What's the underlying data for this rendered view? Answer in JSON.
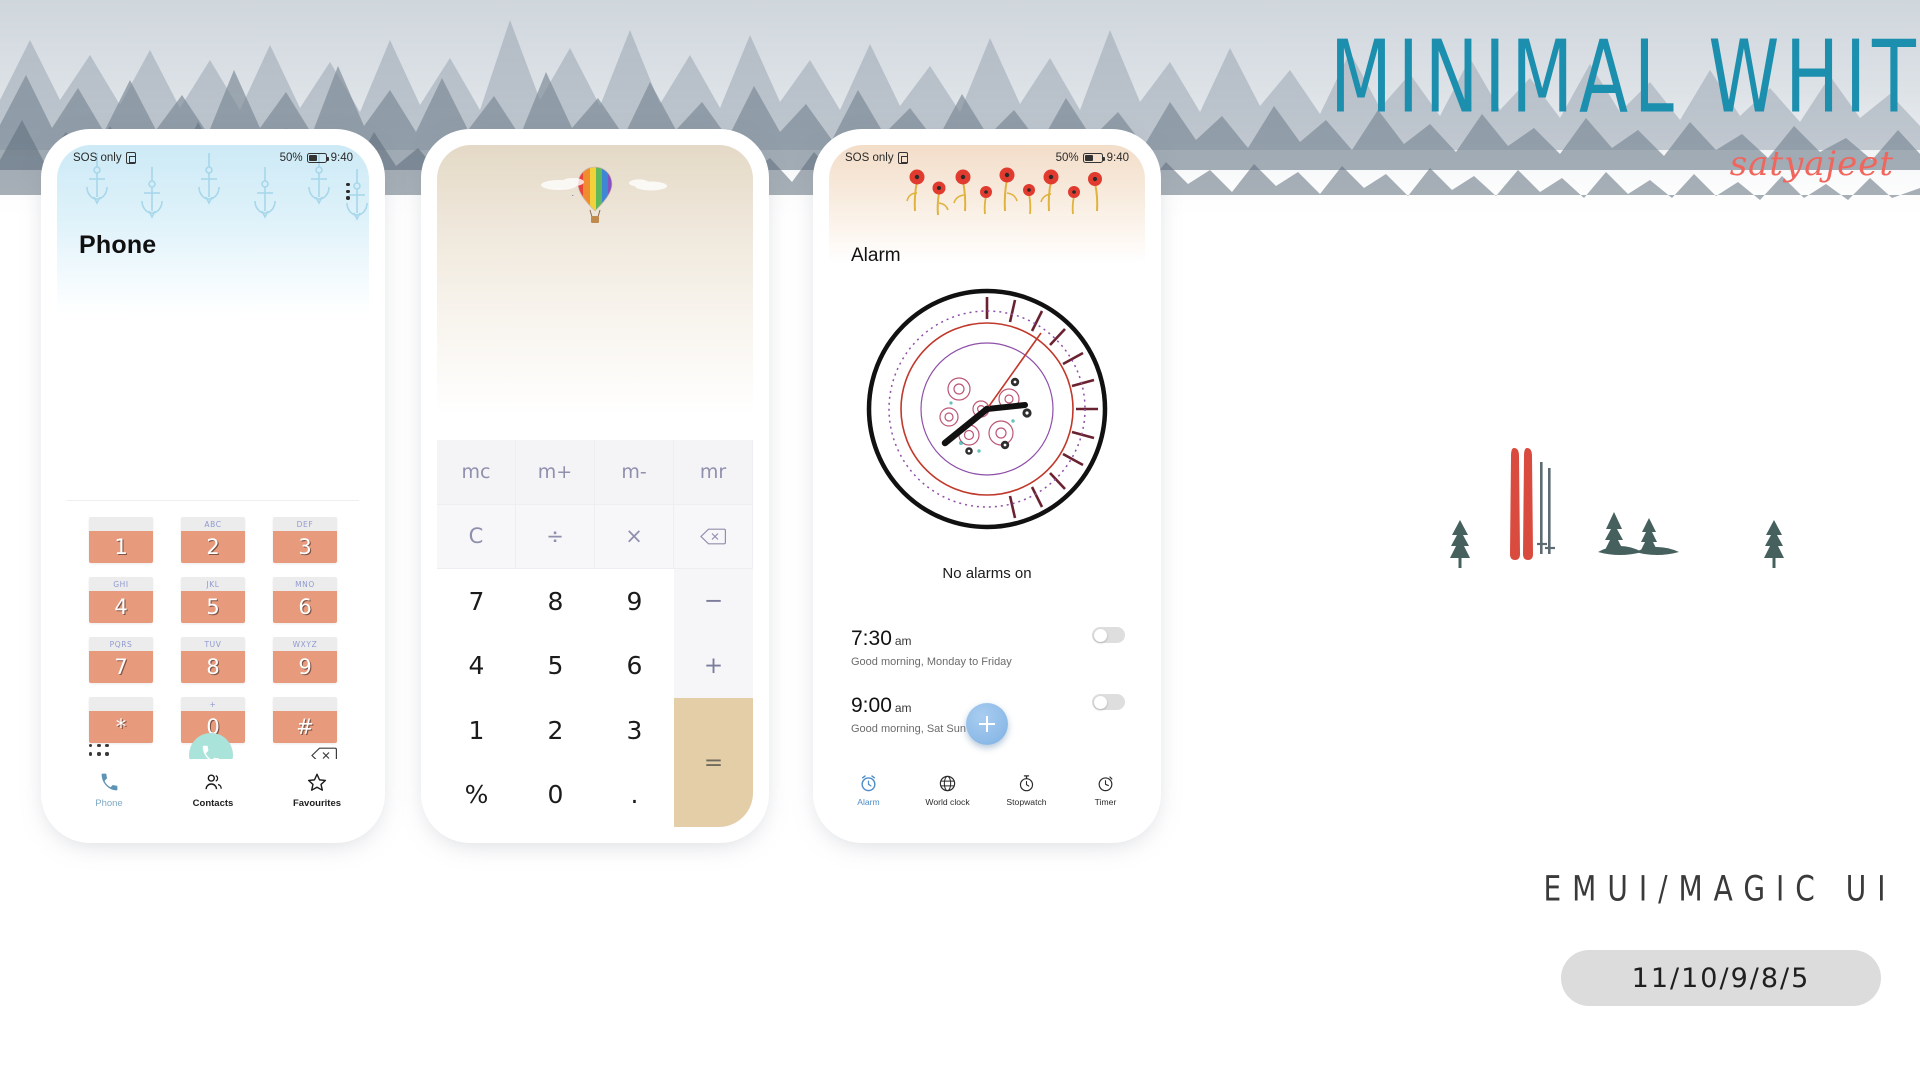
{
  "brand": {
    "title": "MINIMAL WHITE",
    "author": "satyajeet"
  },
  "footer": {
    "platform": "EMUI/MAGIC UI",
    "versions": "11/10/9/8/5"
  },
  "colors": {
    "brand_teal": "#1d8fae",
    "author_coral": "#f0655c",
    "dial_key": "#e89a7d",
    "call_button": "#a9e3da",
    "equals_key": "#e3cea8",
    "fab_blue": "#7fb1e3",
    "active_tab_blue": "#7fa8c4"
  },
  "phone_app": {
    "status": {
      "carrier": "SOS only",
      "battery_pct": "50%",
      "time": "9:40"
    },
    "title": "Phone",
    "keys": [
      {
        "num": "1",
        "letters": ""
      },
      {
        "num": "2",
        "letters": "ABC"
      },
      {
        "num": "3",
        "letters": "DEF"
      },
      {
        "num": "4",
        "letters": "GHI"
      },
      {
        "num": "5",
        "letters": "JKL"
      },
      {
        "num": "6",
        "letters": "MNO"
      },
      {
        "num": "7",
        "letters": "PQRS"
      },
      {
        "num": "8",
        "letters": "TUV"
      },
      {
        "num": "9",
        "letters": "WXYZ"
      },
      {
        "num": "*",
        "letters": ""
      },
      {
        "num": "0",
        "letters": "+"
      },
      {
        "num": "#",
        "letters": ""
      }
    ],
    "tabs": [
      {
        "label": "Phone",
        "icon": "phone-icon",
        "active": true
      },
      {
        "label": "Contacts",
        "icon": "contacts-icon",
        "active": false
      },
      {
        "label": "Favourites",
        "icon": "star-icon",
        "active": false
      }
    ]
  },
  "calculator_app": {
    "rows": [
      [
        {
          "l": "mc",
          "t": "mem"
        },
        {
          "l": "m+",
          "t": "mem"
        },
        {
          "l": "m-",
          "t": "mem"
        },
        {
          "l": "mr",
          "t": "mem"
        }
      ],
      [
        {
          "l": "C",
          "t": "op"
        },
        {
          "l": "÷",
          "t": "op"
        },
        {
          "l": "×",
          "t": "op"
        },
        {
          "l": "backspace-icon",
          "t": "op-icon"
        }
      ],
      [
        {
          "l": "7",
          "t": "num"
        },
        {
          "l": "8",
          "t": "num"
        },
        {
          "l": "9",
          "t": "num"
        },
        {
          "l": "−",
          "t": "side"
        }
      ],
      [
        {
          "l": "4",
          "t": "num"
        },
        {
          "l": "5",
          "t": "num"
        },
        {
          "l": "6",
          "t": "num"
        },
        {
          "l": "+",
          "t": "side"
        }
      ],
      [
        {
          "l": "1",
          "t": "num"
        },
        {
          "l": "2",
          "t": "num"
        },
        {
          "l": "3",
          "t": "num"
        },
        {
          "l": "=",
          "t": "eq"
        }
      ],
      [
        {
          "l": "%",
          "t": "num"
        },
        {
          "l": "0",
          "t": "num"
        },
        {
          "l": ".",
          "t": "num"
        }
      ]
    ]
  },
  "alarm_app": {
    "status": {
      "carrier": "SOS only",
      "battery_pct": "50%",
      "time": "9:40"
    },
    "title": "Alarm",
    "status_text": "No alarms on",
    "alarms": [
      {
        "time": "7:30",
        "meridiem": "am",
        "desc": "Good morning, Monday to Friday",
        "on": false
      },
      {
        "time": "9:00",
        "meridiem": "am",
        "desc": "Good morning, Sat Sun",
        "on": false
      }
    ],
    "add_label": "+",
    "tabs": [
      {
        "label": "Alarm",
        "icon": "alarm-clock-icon",
        "active": true
      },
      {
        "label": "World clock",
        "icon": "globe-icon",
        "active": false
      },
      {
        "label": "Stopwatch",
        "icon": "stopwatch-icon",
        "active": false
      },
      {
        "label": "Timer",
        "icon": "timer-icon",
        "active": false
      }
    ]
  }
}
